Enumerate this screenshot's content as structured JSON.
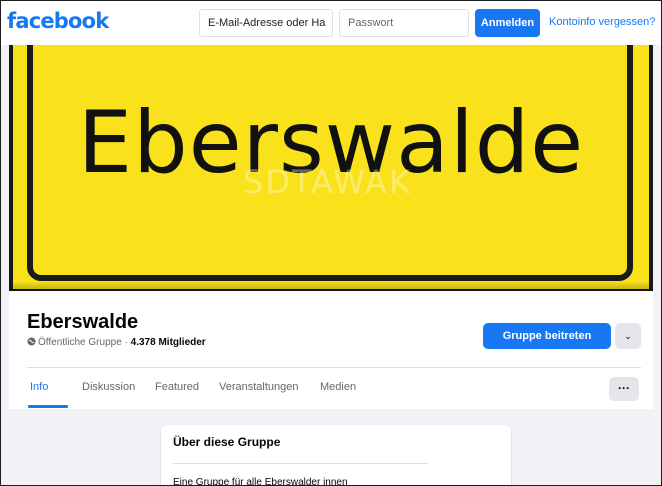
{
  "topbar": {
    "logo": "facebook",
    "email_placeholder": "E-Mail-Adresse oder Ha",
    "password_placeholder": "Passwort",
    "login_label": "Anmelden",
    "forgot_label": "Kontoinfo vergessen?"
  },
  "cover": {
    "sign_text": "Eberswalde",
    "watermark": "SDTAWAK"
  },
  "group": {
    "name": "Eberswalde",
    "privacy": "Öffentliche Gruppe · ",
    "members": "4.378 Mitglieder",
    "join_label": "Gruppe beitreten",
    "more_label": "⌄",
    "dots_label": "···"
  },
  "tabs": [
    {
      "label": "Info",
      "active": true
    },
    {
      "label": "Diskussion",
      "active": false
    },
    {
      "label": "Featured",
      "active": false
    },
    {
      "label": "Veranstaltungen",
      "active": false
    },
    {
      "label": "Medien",
      "active": false
    }
  ],
  "about": {
    "title": "Über diese Gruppe",
    "text": "Eine Gruppe für alle Eberswalder innen"
  },
  "colors": {
    "brand": "#1877f2",
    "sign_yellow": "#f9e21b"
  }
}
